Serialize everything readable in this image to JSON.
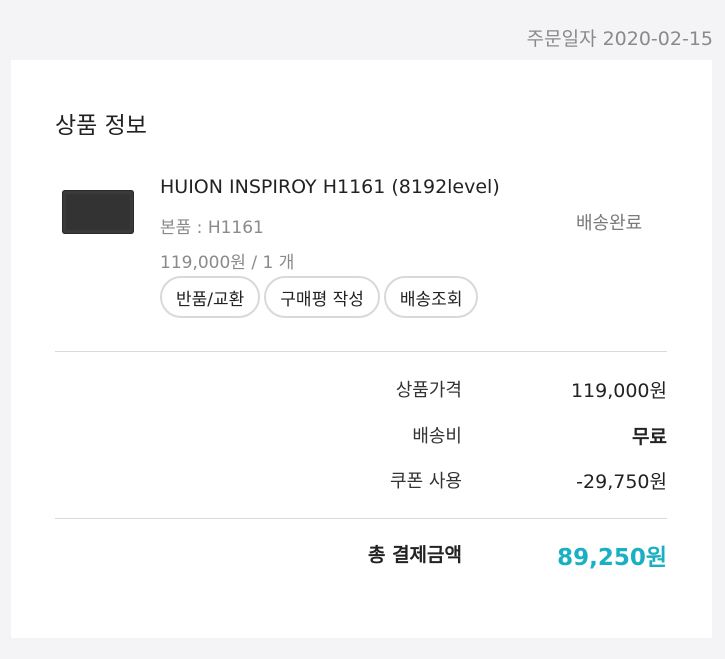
{
  "order": {
    "date_label": "주문일자",
    "date_value": "2020-02-15"
  },
  "section": {
    "title": "상품 정보"
  },
  "product": {
    "name": "HUION INSPIROY H1161 (8192level)",
    "option": "본품 : H1161",
    "price_qty": "119,000원 / 1 개",
    "status": "배송완료",
    "buttons": {
      "return_exchange": "반품/교환",
      "write_review": "구매평 작성",
      "track_delivery": "배송조회"
    }
  },
  "summary": {
    "product_price_label": "상품가격",
    "product_price_value": "119,000원",
    "shipping_label": "배송비",
    "shipping_value": "무료",
    "coupon_label": "쿠폰 사용",
    "coupon_value": "-29,750원",
    "total_label": "총 결제금액",
    "total_value": "89,250원"
  },
  "colors": {
    "accent": "#1ab0c4",
    "background": "#f4f4f6",
    "card": "#ffffff"
  },
  "icons": {
    "product_thumbnail": "drawing-tablet-image"
  }
}
